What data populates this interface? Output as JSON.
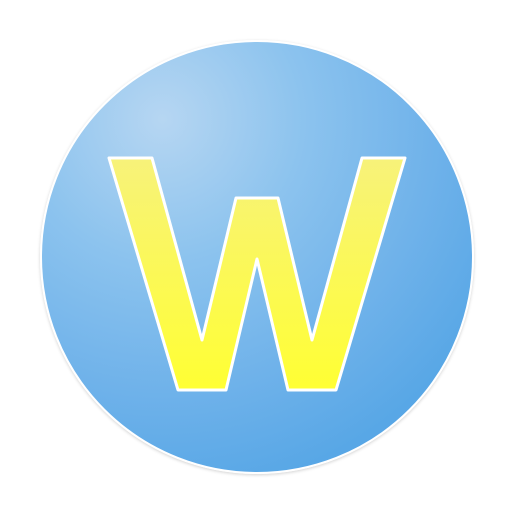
{
  "icon": {
    "letter": "W",
    "letter_color": "#ffff33",
    "letter_highlight": "#f7f27a",
    "outline_color": "#ffffff",
    "circle_color_light": "#b6d6f2",
    "circle_color_dark": "#4da0e4"
  }
}
